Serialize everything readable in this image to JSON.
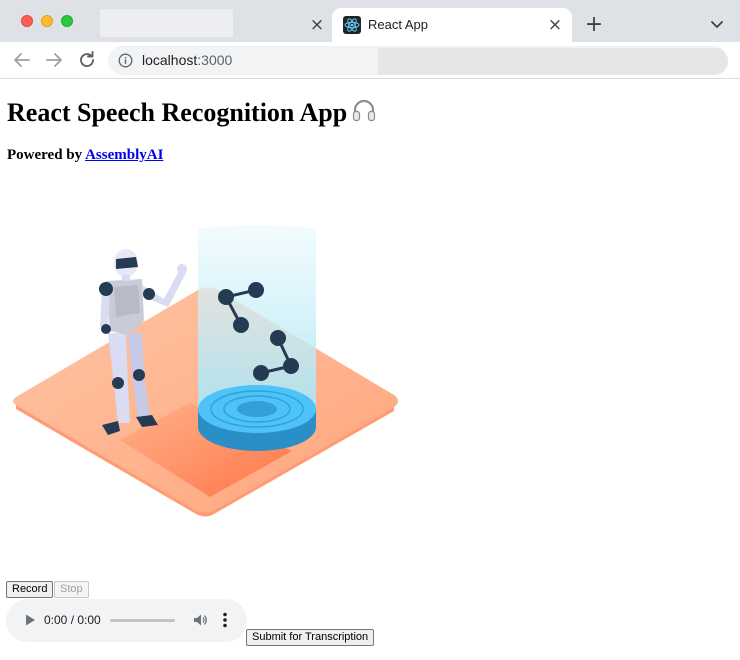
{
  "browser": {
    "active_tab_title": "React App",
    "close_glyph": "×",
    "new_tab_glyph": "+",
    "address": {
      "host": "localhost",
      "port": ":3000"
    }
  },
  "page": {
    "title": "React Speech Recognition App",
    "title_emoji_icon": "headphones-icon",
    "powered_by_prefix": "Powered by",
    "powered_by_link": "AssemblyAI"
  },
  "controls": {
    "record_label": "Record",
    "stop_label": "Stop",
    "submit_label": "Submit for Transcription"
  },
  "audio": {
    "time": "0:00 / 0:00",
    "progress": 0
  },
  "colors": {
    "tab_strip": "#dee1e6",
    "link": "#0000ee",
    "platform": "#ffb08a",
    "hologram": "#bdeaf7",
    "turntable": "#4fc3f7",
    "node": "#243b53"
  }
}
